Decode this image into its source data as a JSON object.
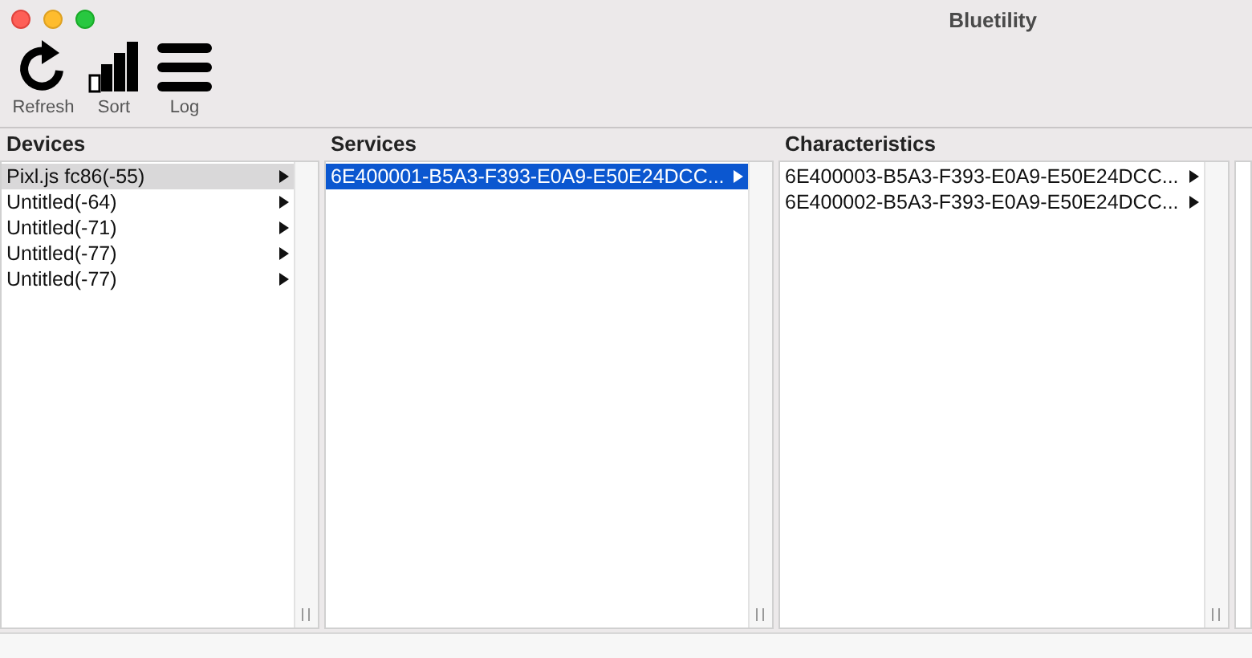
{
  "window": {
    "title": "Bluetility"
  },
  "toolbar": [
    {
      "kind": "refresh",
      "label": "Refresh"
    },
    {
      "kind": "sort",
      "label": "Sort"
    },
    {
      "kind": "log",
      "label": "Log"
    }
  ],
  "columns": [
    {
      "title": "Devices",
      "items": [
        {
          "label": "Pixl.js fc86(-55)",
          "selected": true,
          "focused": false
        },
        {
          "label": "Untitled(-64)",
          "selected": false
        },
        {
          "label": "Untitled(-71)",
          "selected": false
        },
        {
          "label": "Untitled(-77)",
          "selected": false
        },
        {
          "label": "Untitled(-77)",
          "selected": false
        }
      ]
    },
    {
      "title": "Services",
      "items": [
        {
          "label": "6E400001-B5A3-F393-E0A9-E50E24DCC...",
          "selected": true,
          "focused": true
        }
      ]
    },
    {
      "title": "Characteristics",
      "items": [
        {
          "label": "6E400003-B5A3-F393-E0A9-E50E24DCC...",
          "selected": false
        },
        {
          "label": "6E400002-B5A3-F393-E0A9-E50E24DCC...",
          "selected": false
        }
      ]
    }
  ]
}
